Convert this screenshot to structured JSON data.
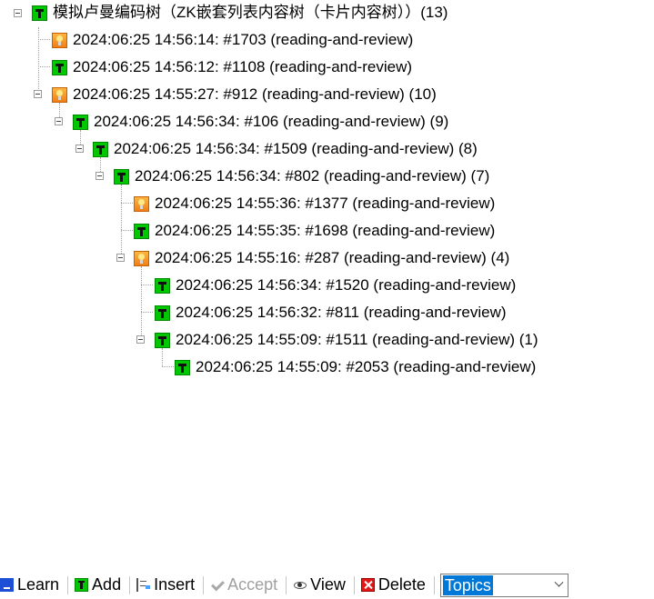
{
  "tree": {
    "root": {
      "label": "模拟卢曼编码树（ZK嵌套列表内容树（卡片内容树））(13)",
      "icon": "topic-icon"
    },
    "items": [
      {
        "label": "2024:06:25 14:56:14: #1703 (reading-and-review)",
        "icon": "item-bulb-icon"
      },
      {
        "label": "2024:06:25 14:56:12: #1108 (reading-and-review)",
        "icon": "topic-icon"
      },
      {
        "label": "2024:06:25 14:55:27: #912 (reading-and-review) (10)",
        "icon": "item-bulb-icon"
      },
      {
        "label": "2024:06:25 14:56:34: #106 (reading-and-review) (9)",
        "icon": "topic-icon"
      },
      {
        "label": "2024:06:25 14:56:34: #1509 (reading-and-review) (8)",
        "icon": "topic-icon"
      },
      {
        "label": "2024:06:25 14:56:34: #802 (reading-and-review) (7)",
        "icon": "topic-icon"
      },
      {
        "label": "2024:06:25 14:55:36: #1377 (reading-and-review)",
        "icon": "item-bulb-icon"
      },
      {
        "label": "2024:06:25 14:55:35: #1698 (reading-and-review)",
        "icon": "topic-icon"
      },
      {
        "label": "2024:06:25 14:55:16: #287 (reading-and-review) (4)",
        "icon": "item-bulb-icon"
      },
      {
        "label": "2024:06:25 14:56:34: #1520 (reading-and-review)",
        "icon": "topic-icon"
      },
      {
        "label": "2024:06:25 14:56:32: #811 (reading-and-review)",
        "icon": "topic-icon"
      },
      {
        "label": "2024:06:25 14:55:09: #1511 (reading-and-review) (1)",
        "icon": "topic-icon"
      },
      {
        "label": "2024:06:25 14:55:09: #2053 (reading-and-review)",
        "icon": "topic-icon"
      }
    ]
  },
  "toolbar": {
    "learn": "Learn",
    "add": "Add",
    "insert": "Insert",
    "accept": "Accept",
    "view": "View",
    "delete": "Delete",
    "combo_value": "Topics"
  },
  "colors": {
    "topic": "#00c800",
    "bulb": "#f39a2a",
    "selection": "#0078d7"
  }
}
